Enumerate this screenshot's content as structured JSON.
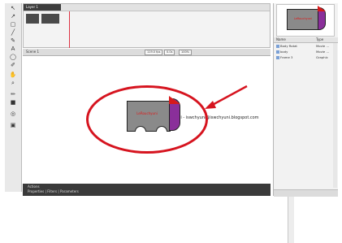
{
  "timeline": {
    "layer_tab": "Layer 1",
    "scene_label": "Scene 1",
    "zoom_chips": [
      "119.0 fps",
      "0.0s",
      "100%"
    ]
  },
  "stage": {
    "watermark": "Esoohyuni - iswchyuni@iswchyuni.blogspot.com",
    "car_label": "LeRouchyuni"
  },
  "library": {
    "preview_label": "LeRouchyuni",
    "col_name": "Name",
    "col_type": "Type",
    "items": [
      {
        "name": "Body Rotat",
        "type": "Movie ..."
      },
      {
        "name": "body",
        "type": "Movie ..."
      },
      {
        "name": "Frame 3",
        "type": "Graphic"
      }
    ]
  },
  "bottom": {
    "label_1": "Actions",
    "label_2": "Properties | Filters | Parameters"
  },
  "colors": {
    "accent_red": "#d6141f",
    "car_purple": "#8a2f9a",
    "car_grey": "#8a8a8a"
  }
}
